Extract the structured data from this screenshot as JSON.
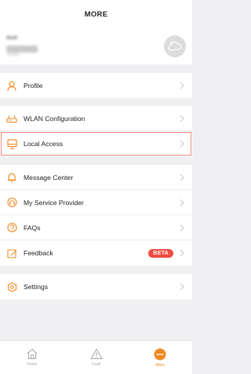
{
  "header": {
    "title": "MORE"
  },
  "account": {
    "name": "Azet",
    "subtitle": "Tenda"
  },
  "colors": {
    "accent": "#f08a24",
    "badge": "#ef4b3e",
    "selection": "#f4877d",
    "chevron": "#c8c8cc"
  },
  "menu": [
    {
      "label": "Profile",
      "icon": "person-icon"
    },
    {
      "label": "WLAN Configuration",
      "icon": "router-icon"
    },
    {
      "label": "Local Access",
      "icon": "monitor-icon",
      "selected": true
    },
    {
      "label": "Message Center",
      "icon": "bell-icon"
    },
    {
      "label": "My Service Provider",
      "icon": "headset-icon"
    },
    {
      "label": "FAQs",
      "icon": "question-icon"
    },
    {
      "label": "Feedback",
      "icon": "edit-icon",
      "badge": "BETA"
    },
    {
      "label": "Settings",
      "icon": "gear-icon"
    }
  ],
  "tabs": [
    {
      "label": "Home",
      "icon": "home-icon"
    },
    {
      "label": "Fault",
      "icon": "warning-icon"
    },
    {
      "label": "More",
      "icon": "more-icon",
      "active": true
    }
  ]
}
